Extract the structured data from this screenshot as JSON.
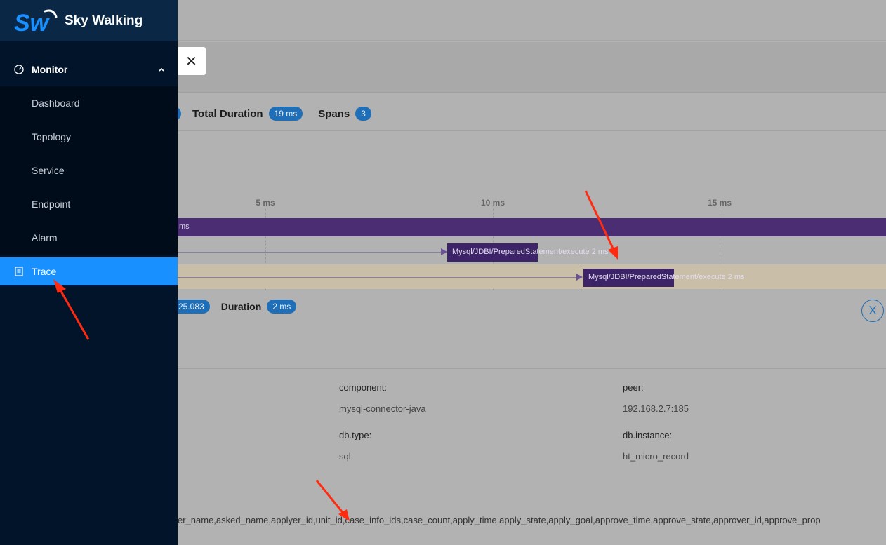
{
  "brand": {
    "name": "Sky Walking",
    "logo_text": "Sw"
  },
  "sidebar": {
    "group": {
      "label": "Monitor",
      "icon": "dashboard-gauge-icon"
    },
    "items": [
      {
        "label": "Dashboard"
      },
      {
        "label": "Topology"
      },
      {
        "label": "Service"
      },
      {
        "label": "Endpoint"
      },
      {
        "label": "Alarm"
      }
    ],
    "active": {
      "label": "Trace",
      "icon": "trace-document-icon"
    }
  },
  "trace_summary": {
    "total_duration_label": "Total Duration",
    "total_duration_value": "19 ms",
    "spans_label": "Spans",
    "spans_value": "3"
  },
  "timeline": {
    "ticks": [
      "5 ms",
      "10 ms",
      "15 ms"
    ],
    "root_row_text": "ms",
    "spans": [
      {
        "label": "Mysql/JDBI/PreparedStatement/execute 2 ms"
      },
      {
        "label": "Mysql/JDBI/PreparedStatement/execute 2 ms"
      }
    ]
  },
  "span_detail": {
    "start_time_fragment": "25.083",
    "duration_label": "Duration",
    "duration_value": "2 ms",
    "tags": [
      {
        "key": "component:",
        "value": "mysql-connector-java"
      },
      {
        "key": "peer:",
        "value": "192.168.2.7:185"
      },
      {
        "key": "db.type:",
        "value": "sql"
      },
      {
        "key": "db.instance:",
        "value": "ht_micro_record"
      }
    ],
    "statement_fragment": "er_name,asked_name,applyer_id,unit_id,case_info_ids,case_count,apply_time,apply_state,apply_goal,approve_time,approve_state,approver_id,approve_prop"
  },
  "colors": {
    "sidebar_bg": "#02142a",
    "active_item": "#1890ff",
    "root_span": "#4a2d73",
    "child_span": "#3d2468",
    "badge": "#1e6fb8",
    "annotation_arrow": "#ff2a10"
  }
}
